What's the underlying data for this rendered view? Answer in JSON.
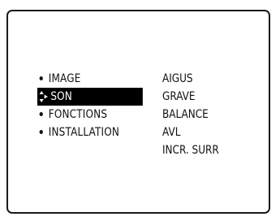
{
  "menu": {
    "items": [
      {
        "label": "IMAGE",
        "selected": false
      },
      {
        "label": "SON",
        "selected": true
      },
      {
        "label": "FONCTIONS",
        "selected": false
      },
      {
        "label": "INSTALLATION",
        "selected": false
      }
    ]
  },
  "submenu": {
    "items": [
      {
        "label": "AIGUS"
      },
      {
        "label": "GRAVE"
      },
      {
        "label": "BALANCE"
      },
      {
        "label": "AVL"
      },
      {
        "label": "INCR. SURR"
      }
    ]
  },
  "icons": {
    "selection_cursor": "up-down-right-arrow-icon",
    "bullet": "bullet-dot-icon"
  },
  "colors": {
    "text": "#111111",
    "highlight_bg": "#000000",
    "highlight_text": "#ffffff",
    "frame": "#1a1a1a"
  }
}
